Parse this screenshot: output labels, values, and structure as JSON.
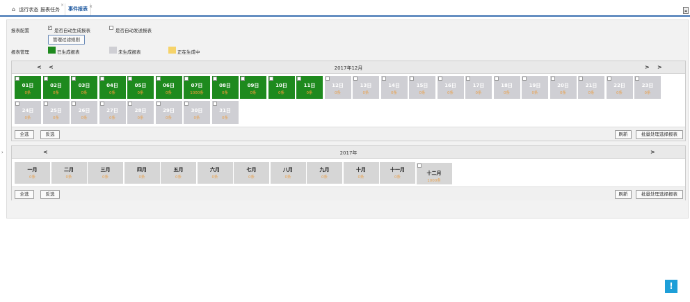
{
  "tabs": [
    {
      "label": "运行状态",
      "closable": false,
      "active": false
    },
    {
      "label": "报表任务",
      "closable": true,
      "active": false
    },
    {
      "label": "事件报表",
      "closable": true,
      "active": true
    }
  ],
  "config": {
    "report_config_label": "报表配置",
    "auto_generate": {
      "label": "是否自动生成报表",
      "checked": true
    },
    "auto_send": {
      "label": "是否自动发送报表",
      "checked": false
    },
    "filter_button": "管理过滤规则",
    "report_manage_label": "报表管理",
    "legend": [
      {
        "label": "已生成报表",
        "color": "#1e8a1e"
      },
      {
        "label": "未生成报表",
        "color": "#cfcfd4"
      },
      {
        "label": "正在生成中",
        "color": "#f6d36a"
      }
    ]
  },
  "day_calendar": {
    "title": "2017年12月",
    "prev_year": "<",
    "prev_month": "<",
    "next_month": ">",
    "next_year": ">",
    "days": [
      {
        "label": "01日",
        "count": "0条",
        "status": "done"
      },
      {
        "label": "02日",
        "count": "0条",
        "status": "done"
      },
      {
        "label": "03日",
        "count": "0条",
        "status": "done"
      },
      {
        "label": "04日",
        "count": "0条",
        "status": "done"
      },
      {
        "label": "05日",
        "count": "0条",
        "status": "done"
      },
      {
        "label": "06日",
        "count": "0条",
        "status": "done"
      },
      {
        "label": "07日",
        "count": "1000条",
        "status": "done"
      },
      {
        "label": "08日",
        "count": "0条",
        "status": "done"
      },
      {
        "label": "09日",
        "count": "0条",
        "status": "done"
      },
      {
        "label": "10日",
        "count": "0条",
        "status": "done"
      },
      {
        "label": "11日",
        "count": "0条",
        "status": "done"
      },
      {
        "label": "12日",
        "count": "0条",
        "status": "none"
      },
      {
        "label": "13日",
        "count": "0条",
        "status": "none"
      },
      {
        "label": "14日",
        "count": "0条",
        "status": "none"
      },
      {
        "label": "15日",
        "count": "0条",
        "status": "none"
      },
      {
        "label": "16日",
        "count": "0条",
        "status": "none"
      },
      {
        "label": "17日",
        "count": "0条",
        "status": "none"
      },
      {
        "label": "18日",
        "count": "0条",
        "status": "none"
      },
      {
        "label": "19日",
        "count": "0条",
        "status": "none"
      },
      {
        "label": "20日",
        "count": "0条",
        "status": "none"
      },
      {
        "label": "21日",
        "count": "0条",
        "status": "none"
      },
      {
        "label": "22日",
        "count": "0条",
        "status": "none"
      },
      {
        "label": "23日",
        "count": "0条",
        "status": "none"
      },
      {
        "label": "24日",
        "count": "0条",
        "status": "none"
      },
      {
        "label": "25日",
        "count": "0条",
        "status": "none"
      },
      {
        "label": "26日",
        "count": "0条",
        "status": "none"
      },
      {
        "label": "27日",
        "count": "0条",
        "status": "none"
      },
      {
        "label": "28日",
        "count": "0条",
        "status": "none"
      },
      {
        "label": "29日",
        "count": "0条",
        "status": "none"
      },
      {
        "label": "30日",
        "count": "0条",
        "status": "none"
      },
      {
        "label": "31日",
        "count": "0条",
        "status": "none"
      }
    ],
    "select_all": "全选",
    "invert": "反选",
    "refresh": "刷新",
    "batch": "批量处理选择报表"
  },
  "month_calendar": {
    "title": "2017年",
    "prev": "<",
    "next": ">",
    "months": [
      {
        "label": "一月",
        "count": "0条"
      },
      {
        "label": "二月",
        "count": "0条"
      },
      {
        "label": "三月",
        "count": "0条"
      },
      {
        "label": "四月",
        "count": "0条"
      },
      {
        "label": "五月",
        "count": "0条"
      },
      {
        "label": "六月",
        "count": "0条"
      },
      {
        "label": "七月",
        "count": "0条"
      },
      {
        "label": "八月",
        "count": "0条"
      },
      {
        "label": "九月",
        "count": "0条"
      },
      {
        "label": "十月",
        "count": "0条"
      },
      {
        "label": "十一月",
        "count": "0条"
      },
      {
        "label": "十二月",
        "count": "1000条",
        "checkbox": true
      }
    ],
    "select_all": "全选",
    "invert": "反选",
    "refresh": "刷新",
    "batch": "批量处理选择报表"
  },
  "help_button": "!"
}
